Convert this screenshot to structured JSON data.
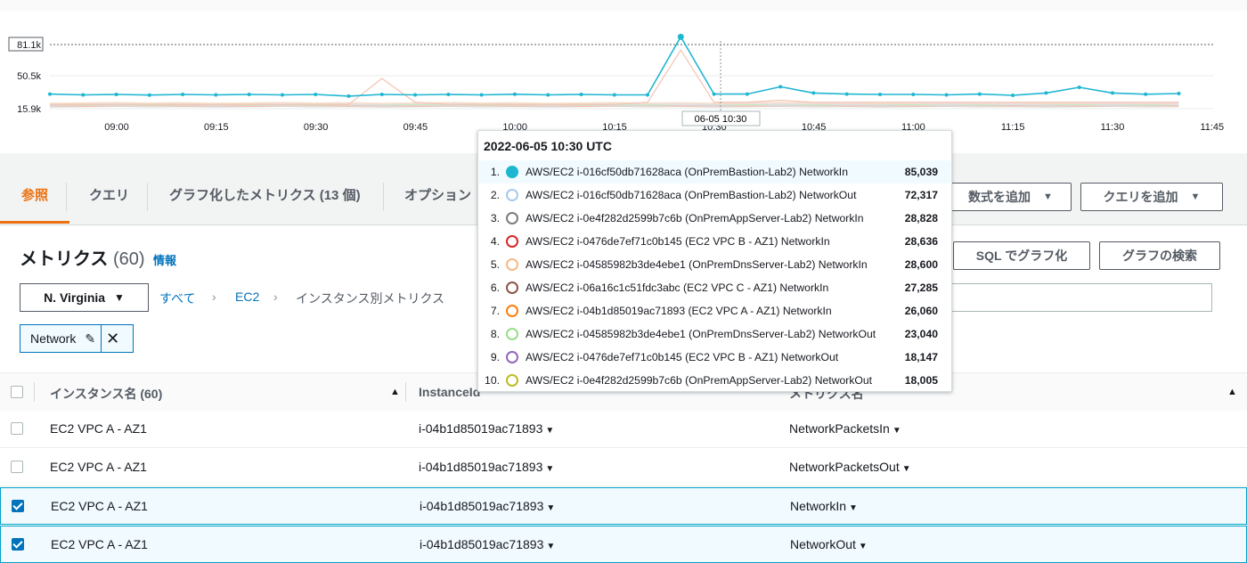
{
  "chart": {
    "y_ticks": [
      "81.1k",
      "50.5k",
      "15.9k"
    ],
    "x_ticks": [
      "09:00",
      "09:15",
      "09:30",
      "09:45",
      "10:00",
      "10:15",
      "10:30",
      "10:45",
      "11:00",
      "11:15",
      "11:30",
      "11:45"
    ],
    "hover_label": "06-05 10:30",
    "colors": {
      "primary": "#1fb6d1",
      "muted": "#f3c3b0",
      "grid": "#d5dbdb"
    }
  },
  "chart_data": {
    "type": "line",
    "x": [
      "08:55",
      "09:00",
      "09:05",
      "09:10",
      "09:15",
      "09:20",
      "09:25",
      "09:30",
      "09:35",
      "09:40",
      "09:45",
      "09:50",
      "09:55",
      "10:00",
      "10:05",
      "10:10",
      "10:15",
      "10:20",
      "10:25",
      "10:30",
      "10:35",
      "10:40",
      "10:45",
      "10:50",
      "10:55",
      "11:00",
      "11:05",
      "11:10",
      "11:15",
      "11:20",
      "11:25",
      "11:30",
      "11:35",
      "11:40"
    ],
    "series": [
      {
        "name": "AWS/EC2 i-016cf50db71628aca (OnPremBastion-Lab2) NetworkIn",
        "values": [
          30000,
          29200,
          29600,
          29000,
          29600,
          29200,
          29600,
          29200,
          29600,
          28000,
          29600,
          29200,
          29600,
          29200,
          29800,
          29200,
          29600,
          29200,
          29200,
          85039,
          30000,
          30000,
          37000,
          31000,
          30000,
          29600,
          29600,
          29200,
          30000,
          28800,
          31000,
          36500,
          31000,
          29800,
          30500
        ]
      },
      {
        "name": "AWS/EC2 i-016cf50db71628aca (OnPremBastion-Lab2) NetworkOut",
        "values": [
          20000,
          20000,
          20000,
          20000,
          20000,
          20000,
          20000,
          20000,
          20000,
          20000,
          45000,
          22000,
          20000,
          20000,
          20000,
          20000,
          20000,
          20000,
          22000,
          72317,
          22000,
          22000,
          24000,
          22000,
          22000,
          22000,
          22000,
          22000,
          22000,
          22000,
          22000,
          22000,
          22000,
          22000,
          22000
        ]
      }
    ],
    "ylim": [
      15900,
      81100
    ]
  },
  "tabs": {
    "items": [
      "参照",
      "クエリ",
      "グラフ化したメトリクス (13 個)",
      "オプション"
    ],
    "add_math": "数式を追加",
    "add_query": "クエリを追加"
  },
  "metrics": {
    "title": "メトリクス",
    "count": "(60)",
    "info": "情報",
    "sql_button": "SQL でグラフ化",
    "graph_search_button": "グラフの検索",
    "region": "N. Virginia",
    "breadcrumb": [
      "すべて",
      "EC2",
      "インスタンス別メトリクス"
    ],
    "token": "Network"
  },
  "table": {
    "headers": [
      "インスタンス名 (60)",
      "InstanceId",
      "メトリクス名"
    ],
    "rows": [
      {
        "name": "EC2 VPC A - AZ1",
        "instance_id": "i-04b1d85019ac71893",
        "metric": "NetworkPacketsIn",
        "checked": false
      },
      {
        "name": "EC2 VPC A - AZ1",
        "instance_id": "i-04b1d85019ac71893",
        "metric": "NetworkPacketsOut",
        "checked": false
      },
      {
        "name": "EC2 VPC A - AZ1",
        "instance_id": "i-04b1d85019ac71893",
        "metric": "NetworkIn",
        "checked": true
      },
      {
        "name": "EC2 VPC A - AZ1",
        "instance_id": "i-04b1d85019ac71893",
        "metric": "NetworkOut",
        "checked": true
      }
    ]
  },
  "tooltip": {
    "title": "2022-06-05 10:30 UTC",
    "rows": [
      {
        "idx": "1.",
        "label": "AWS/EC2 i-016cf50db71628aca (OnPremBastion-Lab2) NetworkIn",
        "value": "85,039",
        "color": "#1fb6d1",
        "filled": true
      },
      {
        "idx": "2.",
        "label": "AWS/EC2 i-016cf50db71628aca (OnPremBastion-Lab2) NetworkOut",
        "value": "72,317",
        "color": "#a9c9ec",
        "filled": false
      },
      {
        "idx": "3.",
        "label": "AWS/EC2 i-0e4f282d2599b7c6b (OnPremAppServer-Lab2) NetworkIn",
        "value": "28,828",
        "color": "#7d7d7d",
        "filled": false
      },
      {
        "idx": "4.",
        "label": "AWS/EC2 i-0476de7ef71c0b145 (EC2 VPC B - AZ1) NetworkIn",
        "value": "28,636",
        "color": "#d62728",
        "filled": false
      },
      {
        "idx": "5.",
        "label": "AWS/EC2 i-04585982b3de4ebe1 (OnPremDnsServer-Lab2) NetworkIn",
        "value": "28,600",
        "color": "#f7b985",
        "filled": false
      },
      {
        "idx": "6.",
        "label": "AWS/EC2 i-06a16c1c51fdc3abc (EC2 VPC C - AZ1) NetworkIn",
        "value": "27,285",
        "color": "#8c564b",
        "filled": false
      },
      {
        "idx": "7.",
        "label": "AWS/EC2 i-04b1d85019ac71893 (EC2 VPC A - AZ1) NetworkIn",
        "value": "26,060",
        "color": "#ff7f0e",
        "filled": false
      },
      {
        "idx": "8.",
        "label": "AWS/EC2 i-04585982b3de4ebe1 (OnPremDnsServer-Lab2) NetworkOut",
        "value": "23,040",
        "color": "#98df8a",
        "filled": false
      },
      {
        "idx": "9.",
        "label": "AWS/EC2 i-0476de7ef71c0b145 (EC2 VPC B - AZ1) NetworkOut",
        "value": "18,147",
        "color": "#9467bd",
        "filled": false
      },
      {
        "idx": "10.",
        "label": "AWS/EC2 i-0e4f282d2599b7c6b (OnPremAppServer-Lab2) NetworkOut",
        "value": "18,005",
        "color": "#bcbd22",
        "filled": false
      }
    ]
  }
}
